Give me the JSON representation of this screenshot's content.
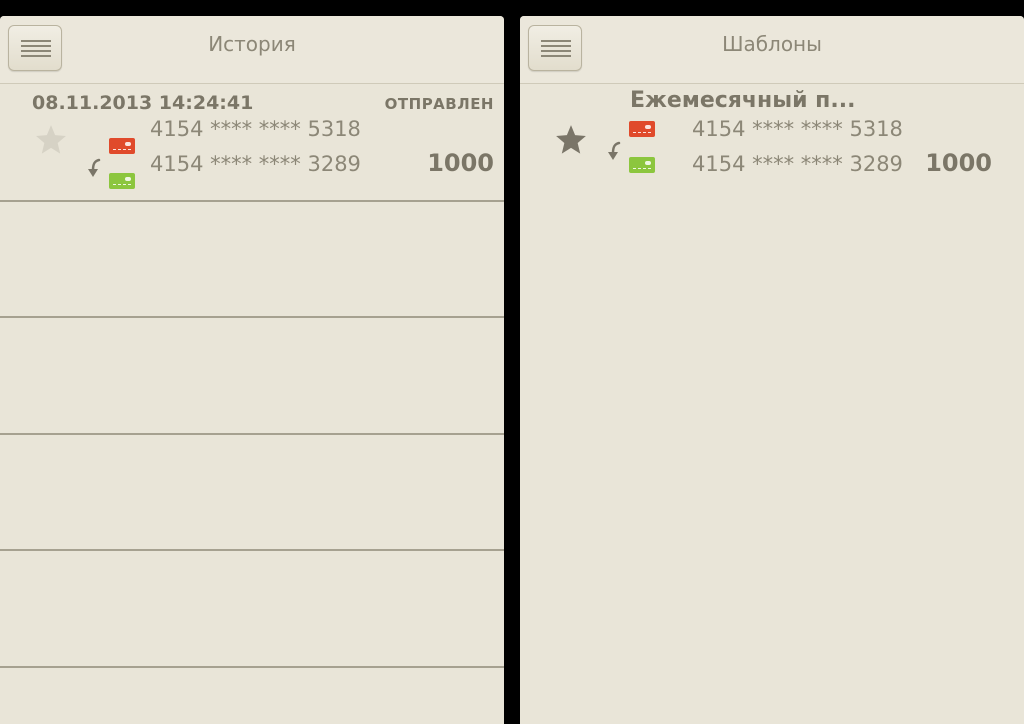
{
  "history_screen": {
    "title": "История",
    "menu_icon": "hamburger-menu-icon",
    "transaction": {
      "datetime": "08.11.2013 14:24:41",
      "status": "ОТПРАВЛЕН",
      "favorite": false,
      "from_card": "4154 **** **** 5318",
      "to_card": "4154 **** **** 3289",
      "amount": "1000"
    }
  },
  "templates_screen": {
    "title": "Шаблоны",
    "menu_icon": "hamburger-menu-icon",
    "template": {
      "name": "Ежемесячный п...",
      "favorite": true,
      "from_card": "4154 **** **** 5318",
      "to_card": "4154 **** **** 3289",
      "amount": "1000"
    }
  },
  "colors": {
    "background": "#e9e5d8",
    "text": "#8c8777",
    "text_bold": "#7b7667",
    "source_card": "#e04a2b",
    "target_card": "#8cc63e",
    "star_inactive": "#d6d2c5",
    "star_active": "#7a7568"
  }
}
